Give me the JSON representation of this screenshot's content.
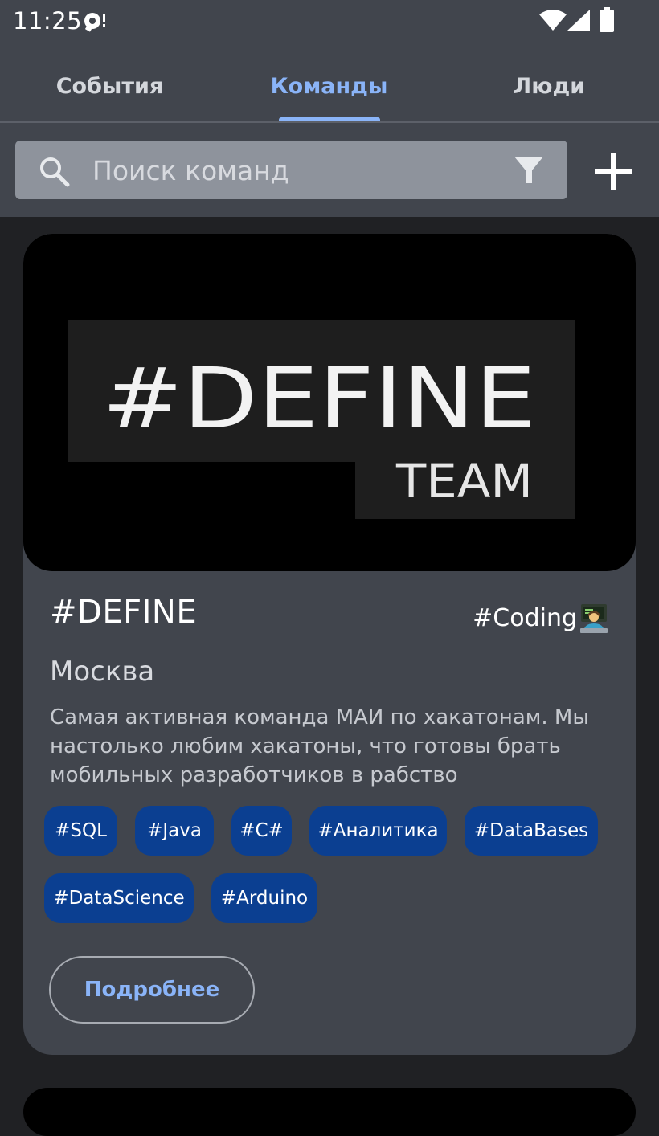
{
  "status_bar": {
    "time": "11:25"
  },
  "tabs": [
    {
      "label": "События",
      "active": false
    },
    {
      "label": "Команды",
      "active": true
    },
    {
      "label": "Люди",
      "active": false
    }
  ],
  "search": {
    "placeholder": "Поиск команд",
    "value": ""
  },
  "icons": {
    "search": "search-icon",
    "filter": "filter-icon",
    "add": "plus-icon",
    "wifi": "wifi-icon",
    "signal": "signal-icon",
    "battery": "battery-icon"
  },
  "card": {
    "logo_main": "#DEFINE",
    "logo_sub": "TEAM",
    "name": "#DEFINE",
    "category": "#Coding",
    "city": "Москва",
    "description": "Самая активная команда МАИ по хакатонам. Мы настолько любим хакатоны, что готовы брать мобильных разработчиков в рабство",
    "tags_row_1": [
      "#SQL",
      "#Java",
      "#C#",
      "#Аналитика",
      "#DataBases"
    ],
    "tags_row_2": [
      "#DataScience",
      "#Arduino"
    ],
    "details_label": "Подробнее"
  },
  "colors": {
    "header_bg": "#41454d",
    "page_bg": "#202124",
    "accent": "#8ab4f8",
    "tag_bg": "#0b3f91"
  }
}
